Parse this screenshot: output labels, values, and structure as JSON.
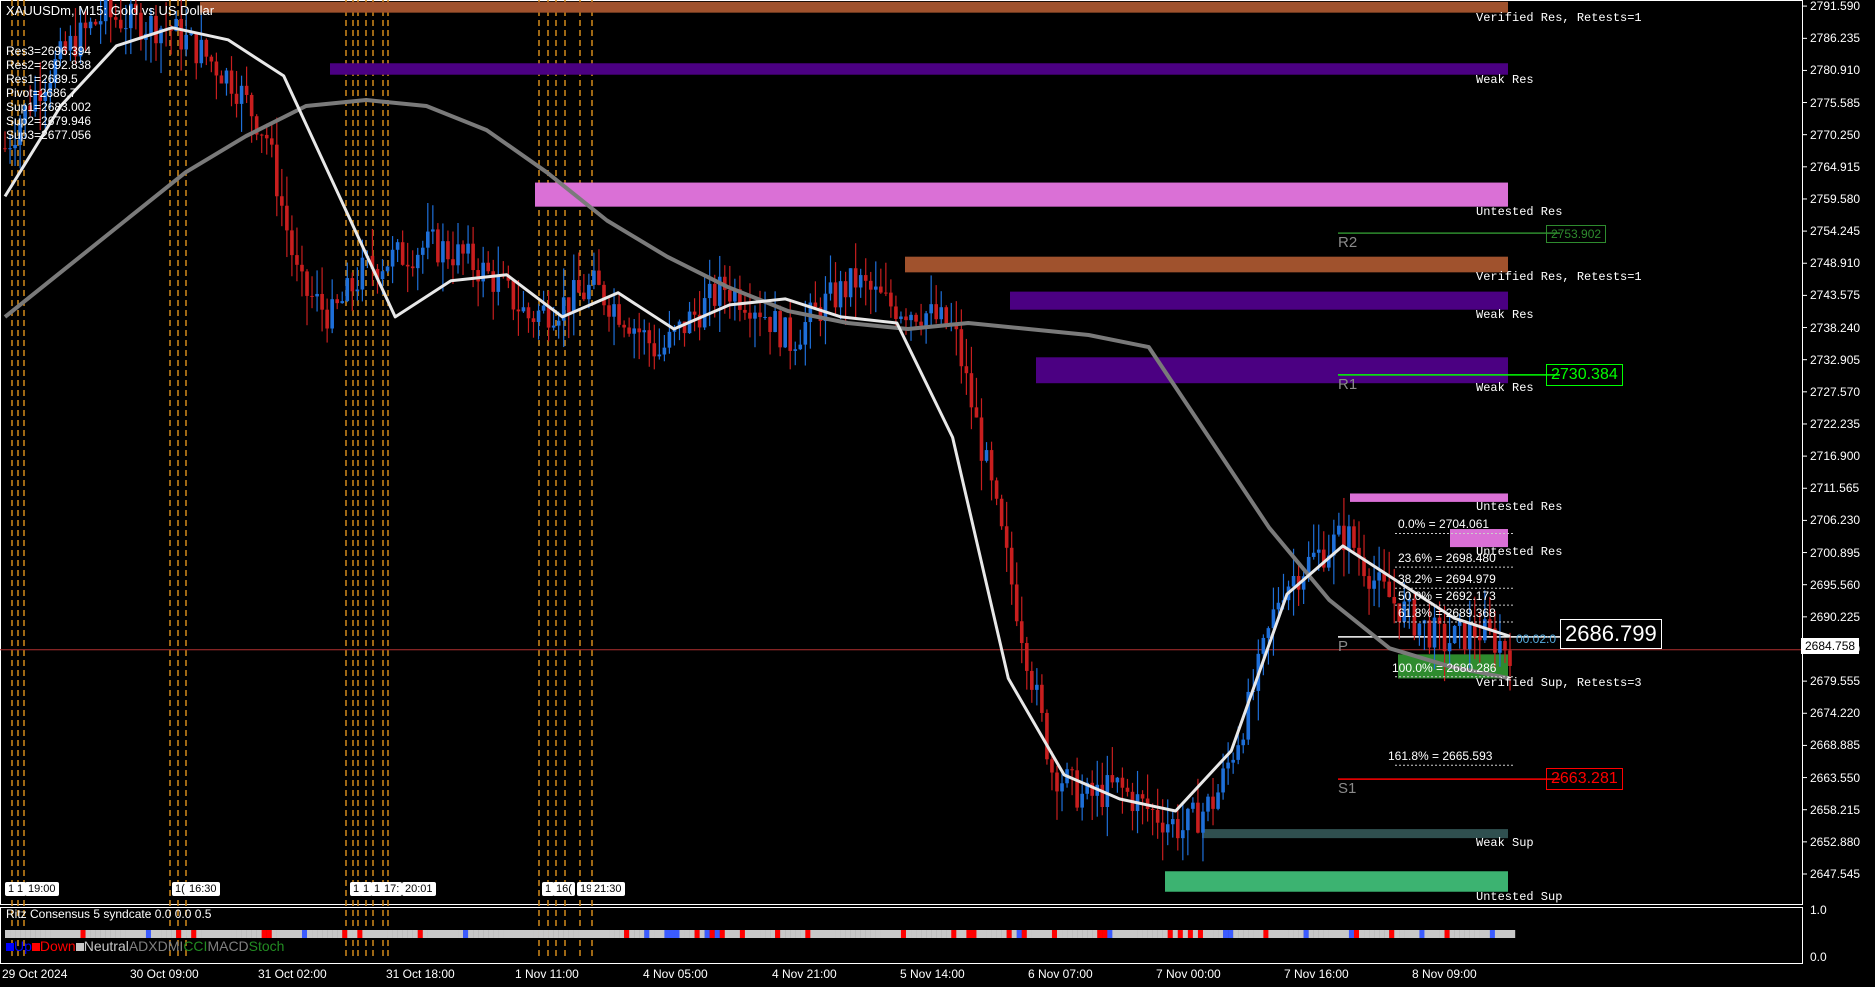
{
  "header": {
    "symbol": "XAUUSDm, M15:",
    "description": "Gold vs US Dollar"
  },
  "pivots": [
    {
      "label": "Res3=2696.394"
    },
    {
      "label": "Res2=2692.838"
    },
    {
      "label": "Res1=2689.5"
    },
    {
      "label": "Pivot=2686.7"
    },
    {
      "label": "Sup1=2683.002"
    },
    {
      "label": "Sup2=2679.946"
    },
    {
      "label": "Sup3=2677.056"
    }
  ],
  "zones": [
    {
      "label": "Verified Res, Retests=1",
      "color": "#a0522d",
      "y1": 2792.3,
      "y2": 2790.5,
      "x_start_label": "29 Oct 2024"
    },
    {
      "label": "Weak Res",
      "color": "#4b0082",
      "y1": 2782.1,
      "y2": 2780.2
    },
    {
      "label": "Untested Res",
      "color": "#da70d6",
      "y1": 2762.3,
      "y2": 2758.3
    },
    {
      "label": "Verified Res, Retests=1",
      "color": "#a0522d",
      "y1": 2750.0,
      "y2": 2747.4
    },
    {
      "label": "Weak Res",
      "color": "#4b0082",
      "y1": 2744.2,
      "y2": 2741.2
    },
    {
      "label": "Weak Res",
      "color": "#4b0082",
      "y1": 2733.3,
      "y2": 2729.0
    },
    {
      "label": "Untested Res",
      "color": "#da70d6",
      "y1": 2710.7,
      "y2": 2709.3
    },
    {
      "label": "Untested Res",
      "color": "#da70d6",
      "y1": 2704.8,
      "y2": 2701.8
    },
    {
      "label": "Verified Sup, Retests=3",
      "color": "#2e8b2e",
      "y1": 2684.0,
      "y2": 2680.0
    },
    {
      "label": "Weak Sup",
      "color": "#2f4f4f",
      "y1": 2655.0,
      "y2": 2653.5
    },
    {
      "label": "Untested Sup",
      "color": "#3cb371",
      "y1": 2648.0,
      "y2": 2644.6
    }
  ],
  "fibonacci": [
    {
      "label": "0.0% = 2704.061",
      "value": 2704.061
    },
    {
      "label": "23.6% = 2698.480",
      "value": 2698.48
    },
    {
      "label": "38.2% = 2694.979",
      "value": 2694.979
    },
    {
      "label": "50.0% = 2692.173",
      "value": 2692.173
    },
    {
      "label": "61.8% = 2689.368",
      "value": 2689.368
    },
    {
      "label": "100.0% = 2680.286",
      "value": 2680.286
    },
    {
      "label": "161.8% = 2665.593",
      "value": 2665.593
    }
  ],
  "pivot_levels": [
    {
      "label": "R2",
      "value": 2753.902,
      "box": "2753.902",
      "color": "#2e8b2e"
    },
    {
      "label": "R1",
      "value": 2730.384,
      "box": "2730.384",
      "color": "#00ff00"
    },
    {
      "label": "P",
      "value": 2686.9,
      "box": "",
      "color": "#ffffff"
    },
    {
      "label": "S1",
      "value": 2663.281,
      "box": "2663.281",
      "color": "#ff0000"
    }
  ],
  "current_price": {
    "value": 2684.758,
    "label": "2684.758"
  },
  "big_price": "2686.799",
  "timer": "00:02:0",
  "sessions": [
    {
      "label": "1"
    },
    {
      "label": "1"
    },
    {
      "label": "19:00"
    },
    {
      "label": "1("
    },
    {
      "label": "16:30"
    },
    {
      "label": "1"
    },
    {
      "label": "1"
    },
    {
      "label": "1"
    },
    {
      "label": "17:"
    },
    {
      "label": "20:01"
    },
    {
      "label": "1"
    },
    {
      "label": "16("
    },
    {
      "label": "19"
    },
    {
      "label": "21:30"
    }
  ],
  "indicator": {
    "name": "Ritz Consensus 5 syndcate 0.0 0.0 0.5",
    "levels": [
      "1.0",
      "0.0"
    ],
    "legend": [
      {
        "label": "Up",
        "color": "#0000ff"
      },
      {
        "label": "Down",
        "color": "#ff0000"
      },
      {
        "label": "Neutral",
        "color": "#c8c8c8"
      },
      {
        "label": "ADX",
        "color": "#808080"
      },
      {
        "label": "DMI",
        "color": "#808080"
      },
      {
        "label": "CCI",
        "color": "#228b22"
      },
      {
        "label": "MACD",
        "color": "#808080"
      },
      {
        "label": "Stoch",
        "color": "#228b22"
      }
    ]
  },
  "chart_data": {
    "type": "candlestick",
    "title": "XAUUSDm, M15: Gold vs US Dollar",
    "ylim": [
      2642.4,
      2792.6
    ],
    "y_ticks": [
      "2791.590",
      "2786.235",
      "2780.910",
      "2775.585",
      "2770.250",
      "2764.915",
      "2759.580",
      "2754.245",
      "2748.910",
      "2743.575",
      "2738.240",
      "2732.905",
      "2727.570",
      "2722.235",
      "2716.900",
      "2711.565",
      "2706.230",
      "2700.895",
      "2695.560",
      "2690.225",
      "2684.890",
      "2679.555",
      "2674.220",
      "2668.885",
      "2663.550",
      "2658.215",
      "2652.880",
      "2647.545"
    ],
    "x_ticks": [
      "29 Oct 2024",
      "30 Oct 09:00",
      "31 Oct 02:00",
      "31 Oct 18:00",
      "1 Nov 11:00",
      "4 Nov 05:00",
      "4 Nov 21:00",
      "5 Nov 14:00",
      "6 Nov 07:00",
      "7 Nov 00:00",
      "7 Nov 16:00",
      "8 Nov 09:00"
    ],
    "price_path": [
      2768,
      2778,
      2785,
      2790,
      2789,
      2788,
      2784,
      2779,
      2770,
      2745,
      2740,
      2748,
      2750,
      2752,
      2750,
      2746,
      2740,
      2742,
      2745,
      2740,
      2734,
      2740,
      2745,
      2742,
      2736,
      2742,
      2746,
      2742,
      2741,
      2738,
      2715,
      2690,
      2665,
      2660,
      2662,
      2658,
      2655,
      2660,
      2675,
      2695,
      2700,
      2704,
      2695,
      2690,
      2686,
      2688,
      2685
    ],
    "slow_ma": [
      2740,
      2748,
      2756,
      2764,
      2770,
      2775,
      2776,
      2775,
      2771,
      2764,
      2756,
      2750,
      2745,
      2741,
      2739,
      2738,
      2739,
      2738,
      2737,
      2735,
      2720,
      2705,
      2693,
      2685,
      2682,
      2680
    ],
    "fast_ma": [
      2760,
      2775,
      2785,
      2788,
      2786,
      2780,
      2760,
      2740,
      2746,
      2747,
      2740,
      2744,
      2738,
      2742,
      2743,
      2740,
      2739,
      2720,
      2680,
      2664,
      2660,
      2658,
      2668,
      2694,
      2702,
      2696,
      2690,
      2687
    ]
  }
}
